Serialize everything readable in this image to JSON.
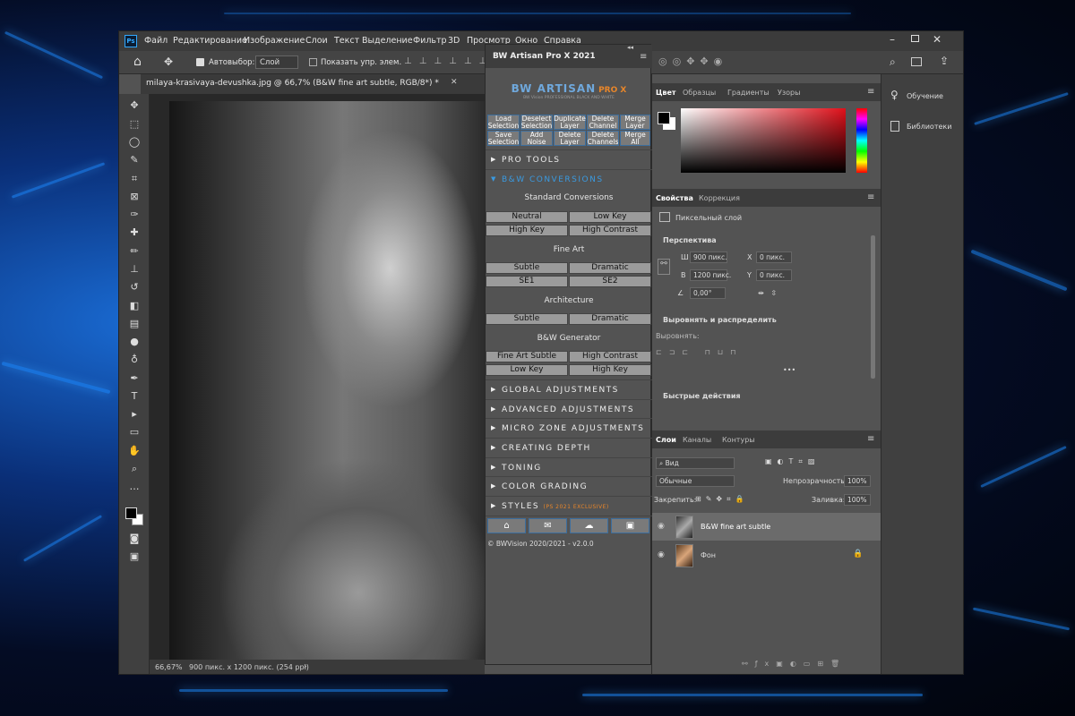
{
  "app": {
    "ps_logo": "Ps",
    "menu": [
      "Файл",
      "Редактирование",
      "Изображение",
      "Слои",
      "Текст",
      "Выделение",
      "Фильтр",
      "3D",
      "Просмотр",
      "Окно",
      "Справка"
    ]
  },
  "options": {
    "autoselect_label": "Автовыбор:",
    "autoselect_value": "Слой",
    "show_controls_label": "Показать упр. элем."
  },
  "document": {
    "tab_title": "milaya-krasivaya-devushka.jpg @ 66,7% (B&W fine art subtle, RGB/8*) *",
    "zoom": "66,67%",
    "info": "900 пикс. x 1200 пикс. (254 ppi)"
  },
  "plugin": {
    "title": "BW Artisan Pro X 2021",
    "logo_text": "BW ARTISAN",
    "logo_accent": "PRO X",
    "logo_sub": "BW Vision PROFESSIONAL BLACK AND WHITE",
    "top_buttons": [
      [
        "Load",
        "Selection"
      ],
      [
        "Deselect",
        "Selection"
      ],
      [
        "Duplicate",
        "Layer"
      ],
      [
        "Delete",
        "Channel"
      ],
      [
        "Merge",
        "Layer"
      ],
      [
        "Save",
        "Selection"
      ],
      [
        "Add",
        "Noise"
      ],
      [
        "Delete",
        "Layer"
      ],
      [
        "Delete",
        "Channels"
      ],
      [
        "Merge",
        "All"
      ]
    ],
    "sections": {
      "pro_tools": "PRO TOOLS",
      "bw_conversions": "B&W CONVERSIONS",
      "global": "GLOBAL ADJUSTMENTS",
      "advanced": "ADVANCED ADJUSTMENTS",
      "micro": "MICRO ZONE ADJUSTMENTS",
      "depth": "CREATING DEPTH",
      "toning": "TONING",
      "grading": "COLOR GRADING",
      "styles": "STYLES",
      "styles_badge": "(PS 2021 EXCLUSIVE)"
    },
    "groups": {
      "standard": {
        "title": "Standard Conversions",
        "buttons": [
          "Neutral",
          "Low Key",
          "High Key",
          "High Contrast"
        ]
      },
      "fineart": {
        "title": "Fine Art",
        "buttons": [
          "Subtle",
          "Dramatic",
          "SE1",
          "SE2"
        ]
      },
      "architecture": {
        "title": "Architecture",
        "buttons": [
          "Subtle",
          "Dramatic"
        ]
      },
      "generator": {
        "title": "B&W Generator",
        "buttons": [
          "Fine Art Subtle",
          "High Contrast",
          "Low Key",
          "High Key"
        ]
      }
    },
    "footer": "© BWVision 2020/2021 - v2.0.0"
  },
  "color_panel": {
    "tabs": [
      "Цвет",
      "Образцы",
      "Градиенты",
      "Узоры"
    ]
  },
  "properties": {
    "tabs": [
      "Свойства",
      "Коррекция"
    ],
    "layer_type": "Пиксельный слой",
    "perspective": "Перспектива",
    "w_label": "Ш",
    "w": "900 пикс.",
    "h_label": "В",
    "h": "1200 пикс.",
    "x_label": "X",
    "x": "0 пикс.",
    "y_label": "Y",
    "y": "0 пикс.",
    "angle": "0,00°",
    "align_title": "Выровнять и распределить",
    "align_sub": "Выровнять:",
    "quick": "Быстрые действия"
  },
  "layers": {
    "tabs": [
      "Слои",
      "Каналы",
      "Контуры"
    ],
    "kind": "Вид",
    "blend": "Обычные",
    "opacity_label": "Непрозрачность:",
    "opacity": "100%",
    "lock_label": "Закрепить:",
    "fill_label": "Заливка:",
    "fill": "100%",
    "items": [
      "B&W fine art subtle",
      "Фон"
    ]
  },
  "right_dock": {
    "learn": "Обучение",
    "libraries": "Библиотеки"
  },
  "colors": {
    "accent": "#3a7fc4",
    "panel": "#535353",
    "button_border": "#3c6e9e",
    "orange": "#e8862a"
  }
}
